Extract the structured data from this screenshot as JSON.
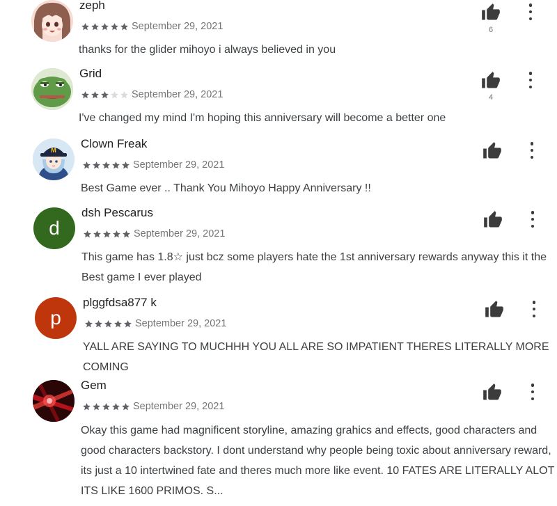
{
  "colors": {
    "star_filled": "#5f6368",
    "star_empty": "#dadce0",
    "date_text": "#757575",
    "icon_dark": "#3c3c3c"
  },
  "reviews": [
    {
      "author": "zeph",
      "rating": 5,
      "date": "September 29, 2021",
      "text": "thanks for the glider mihoyo i always believed in you",
      "helpful_count": "6",
      "avatar": {
        "type": "image",
        "description_icon": "anime-girl-avatar-icon"
      }
    },
    {
      "author": "Grid",
      "rating": 3,
      "date": "September 29, 2021",
      "text": "I've changed my mind I'm hoping this anniversary will become a better one",
      "helpful_count": "4",
      "avatar": {
        "type": "image",
        "description_icon": "frog-avatar-icon"
      }
    },
    {
      "author": "Clown Freak",
      "rating": 5,
      "date": "September 29, 2021",
      "text": "Best Game ever .. Thank You Mihoyo Happy Anniversary !!",
      "helpful_count": "",
      "avatar": {
        "type": "image",
        "description_icon": "anime-character-avatar-icon"
      }
    },
    {
      "author": "dsh Pescarus",
      "rating": 5,
      "date": "September 29, 2021",
      "text": "This game has 1.8☆ just bcz some players hate the 1st anniversary rewards anyway this it the Best game I ever played",
      "helpful_count": "",
      "avatar": {
        "type": "letter",
        "letter": "d",
        "color": "#33691e"
      }
    },
    {
      "author": "plggfdsa877 k",
      "rating": 5,
      "date": "September 29, 2021",
      "text": "YALL ARE SAYING TO MUCHHH YOU ALL ARE SO IMPATIENT THERES LITERALLY MORE COMING",
      "helpful_count": "",
      "avatar": {
        "type": "letter",
        "letter": "p",
        "color": "#bf360c"
      }
    },
    {
      "author": "Gem",
      "rating": 5,
      "date": "September 29, 2021",
      "text": "Okay this game had magnificent storyline, amazing grahics and effects, good characters and good characters backstory. I dont understand why people being toxic about anniversary reward, its just a 10 intertwined fate and theres much more like event. 10 FATES ARE LITERALLY ALOT ITS LIKE 1600 PRIMOS. S...",
      "helpful_count": "",
      "avatar": {
        "type": "image",
        "description_icon": "red-abstract-avatar-icon"
      }
    }
  ]
}
